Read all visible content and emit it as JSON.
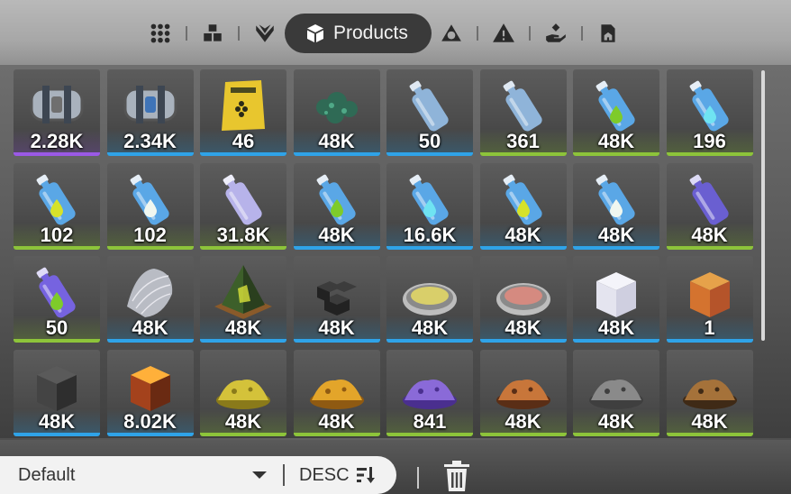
{
  "tabs": {
    "active_label": "Products",
    "icons": [
      "all-grid-icon",
      "structures-icon",
      "plants-icon",
      "products-icon",
      "ore-icon",
      "warning-triangle-icon",
      "hand-give-icon",
      "blueprint-icon"
    ]
  },
  "colors": {
    "purple": "#9b59e6",
    "blue": "#2fa3e8",
    "green": "#8dc43a"
  },
  "items": [
    {
      "qty": "2.28K",
      "rarity": "purple",
      "icon": "canister-capsule-icon"
    },
    {
      "qty": "2.34K",
      "rarity": "blue",
      "icon": "canister-capsule-blue-icon"
    },
    {
      "qty": "46",
      "rarity": "blue",
      "icon": "seed-bag-icon"
    },
    {
      "qty": "48K",
      "rarity": "blue",
      "icon": "algae-clump-icon"
    },
    {
      "qty": "50",
      "rarity": "blue",
      "icon": "water-bottle-icon"
    },
    {
      "qty": "361",
      "rarity": "green",
      "icon": "water-bottle-icon"
    },
    {
      "qty": "48K",
      "rarity": "green",
      "icon": "green-drop-bottle-icon"
    },
    {
      "qty": "196",
      "rarity": "green",
      "icon": "cyan-drop-bottle-icon"
    },
    {
      "qty": "102",
      "rarity": "green",
      "icon": "yellow-drop-bottle-icon"
    },
    {
      "qty": "102",
      "rarity": "green",
      "icon": "white-drop-bottle-icon"
    },
    {
      "qty": "31.8K",
      "rarity": "green",
      "icon": "lavender-bottle-icon"
    },
    {
      "qty": "48K",
      "rarity": "blue",
      "icon": "green-drop-bottle-icon"
    },
    {
      "qty": "16.6K",
      "rarity": "blue",
      "icon": "cyan-drop-bottle-icon"
    },
    {
      "qty": "48K",
      "rarity": "blue",
      "icon": "yellow-drop-bottle-icon"
    },
    {
      "qty": "48K",
      "rarity": "blue",
      "icon": "white-drop-bottle-icon"
    },
    {
      "qty": "48K",
      "rarity": "green",
      "icon": "violet-bottle-icon"
    },
    {
      "qty": "50",
      "rarity": "green",
      "icon": "violet-drop-bottle-icon"
    },
    {
      "qty": "48K",
      "rarity": "blue",
      "icon": "mesh-fabric-icon"
    },
    {
      "qty": "48K",
      "rarity": "blue",
      "icon": "crystal-pyramid-icon"
    },
    {
      "qty": "48K",
      "rarity": "blue",
      "icon": "carbon-blocks-icon"
    },
    {
      "qty": "48K",
      "rarity": "blue",
      "icon": "yellow-powder-dish-icon"
    },
    {
      "qty": "48K",
      "rarity": "blue",
      "icon": "pink-powder-dish-icon"
    },
    {
      "qty": "48K",
      "rarity": "blue",
      "icon": "white-cube-icon"
    },
    {
      "qty": "1",
      "rarity": "blue",
      "icon": "orange-cube-icon"
    },
    {
      "qty": "48K",
      "rarity": "blue",
      "icon": "dark-cube-icon"
    },
    {
      "qty": "8.02K",
      "rarity": "blue",
      "icon": "molten-cube-icon"
    },
    {
      "qty": "48K",
      "rarity": "green",
      "icon": "gold-ore-pile-icon"
    },
    {
      "qty": "48K",
      "rarity": "green",
      "icon": "amber-ore-pile-icon"
    },
    {
      "qty": "841",
      "rarity": "green",
      "icon": "purple-ore-pile-icon"
    },
    {
      "qty": "48K",
      "rarity": "green",
      "icon": "copper-ore-pile-icon"
    },
    {
      "qty": "48K",
      "rarity": "green",
      "icon": "grey-ore-pile-icon"
    },
    {
      "qty": "48K",
      "rarity": "green",
      "icon": "bronze-ore-pile-icon"
    }
  ],
  "sort": {
    "selected": "Default",
    "order_label": "DESC"
  }
}
